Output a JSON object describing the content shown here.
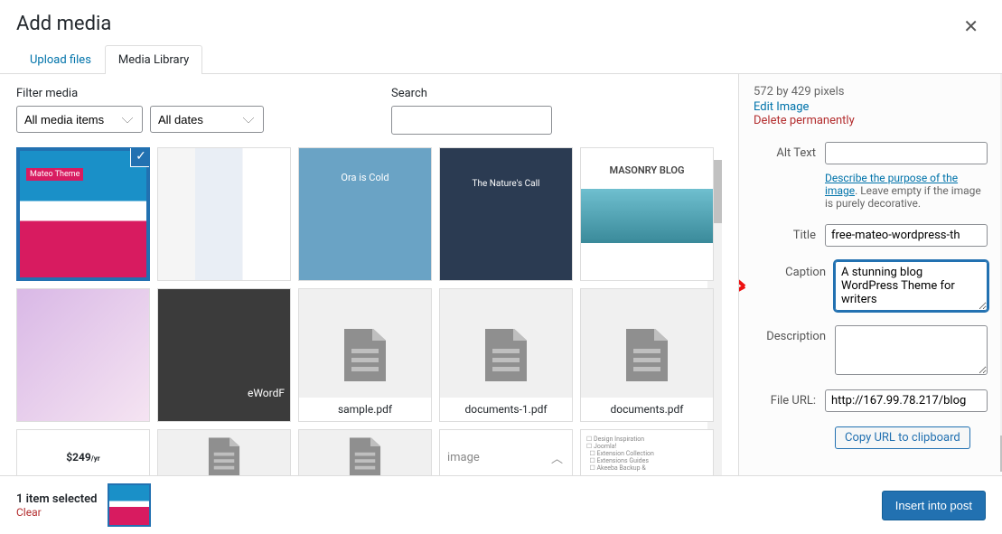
{
  "header": {
    "title": "Add media"
  },
  "tabs": [
    {
      "id": "upload",
      "label": "Upload files",
      "active": false
    },
    {
      "id": "library",
      "label": "Media Library",
      "active": true
    }
  ],
  "filters": {
    "label": "Filter media",
    "type_selected": "All media items",
    "date_selected": "All dates"
  },
  "search": {
    "label": "Search",
    "value": ""
  },
  "grid_items": [
    {
      "kind": "image",
      "selected": true,
      "name": "theme-mateo"
    },
    {
      "kind": "image",
      "selected": false,
      "name": "theme-blog-layout"
    },
    {
      "kind": "image",
      "selected": false,
      "name": "theme-ora",
      "overlay": "Ora is Cold"
    },
    {
      "kind": "image",
      "selected": false,
      "name": "theme-nature",
      "overlay": "The Nature's Call"
    },
    {
      "kind": "image",
      "selected": false,
      "name": "theme-masonry",
      "overlay": "MASONRY BLOG"
    },
    {
      "kind": "image",
      "selected": false,
      "name": "flowers-pink"
    },
    {
      "kind": "image",
      "selected": false,
      "name": "ewordpress-banner",
      "overlay": "eWordF"
    },
    {
      "kind": "file",
      "selected": false,
      "name": "sample-pdf",
      "caption": "sample.pdf"
    },
    {
      "kind": "file",
      "selected": false,
      "name": "documents-1-pdf",
      "caption": "documents-1.pdf"
    },
    {
      "kind": "file",
      "selected": false,
      "name": "documents-pdf",
      "caption": "documents.pdf"
    },
    {
      "kind": "image-partial",
      "selected": false,
      "name": "pricing-card"
    },
    {
      "kind": "file-partial",
      "selected": false,
      "name": "file-row2-a"
    },
    {
      "kind": "file-partial",
      "selected": false,
      "name": "file-row2-b"
    },
    {
      "kind": "image-partial",
      "selected": false,
      "name": "image-placeholder",
      "overlay": "image"
    },
    {
      "kind": "list-partial",
      "selected": false,
      "name": "checklist-card"
    }
  ],
  "details": {
    "dimensions_text": "572 by 429 pixels",
    "edit_label": "Edit Image",
    "delete_label": "Delete permanently",
    "alt_label": "Alt Text",
    "alt_value": "",
    "alt_help_link": "Describe the purpose of the image",
    "alt_help_rest": ". Leave empty if the image is purely decorative.",
    "title_label": "Title",
    "title_value": "free-mateo-wordpress-th",
    "caption_label": "Caption",
    "caption_value": "A stunning blog WordPress Theme for writers",
    "description_label": "Description",
    "description_value": "",
    "fileurl_label": "File URL:",
    "fileurl_value": "http://167.99.78.217/blog",
    "copy_label": "Copy URL to clipboard"
  },
  "footer": {
    "selected_text": "1 item selected",
    "clear_label": "Clear",
    "insert_label": "Insert into post"
  }
}
